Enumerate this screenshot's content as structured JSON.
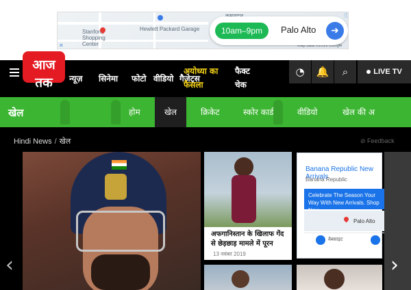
{
  "ad_banner": {
    "hours": "10am–9pm",
    "city": "Palo Alto",
    "map_labels": [
      "कमलदल",
      "Stanford Shopping Center",
      "Hewlett Packard Garage",
      "Map data ©2019 Google"
    ],
    "close": "✕",
    "info": "ⓘ"
  },
  "header": {
    "logo_text": "आज तक",
    "nav": [
      "न्यूज़",
      "सिनेमा",
      "फोटो",
      "वीडियो",
      "गैजेट्स",
      "अयोध्या का फैसला",
      "फैक्ट चेक"
    ],
    "live_label": "LIVE TV",
    "icons": [
      "speedometer-icon",
      "bell-icon",
      "search-icon"
    ]
  },
  "section": {
    "title": "खेल",
    "tabs": [
      "होम",
      "खेल",
      "क्रिकेट",
      "स्कोर कार्ड",
      "वीडियो",
      "खेल की अ"
    ],
    "active_tab": "खेल"
  },
  "breadcrumb": {
    "home": "Hindi News",
    "separator": "/",
    "current": "खेल"
  },
  "feedback": "Feedback",
  "cards": [
    {
      "title": "अफगानिस्तान के खिलाफ गेंद से छेड़छाड़ मामले में पूरन",
      "date": "13 नवंबर 2019"
    }
  ],
  "ad_side": {
    "title": "Banana Republic New Arrivals",
    "sub": "Banana Republic",
    "cta": "Celebrate The Season Your Way With New Arrivals. Shop Now",
    "map_label": "Palo Alto",
    "foot_left": "वेबसाइट",
    "foot_right": "दिशाएँ"
  },
  "arrows": {
    "prev": "‹",
    "next": "›"
  }
}
